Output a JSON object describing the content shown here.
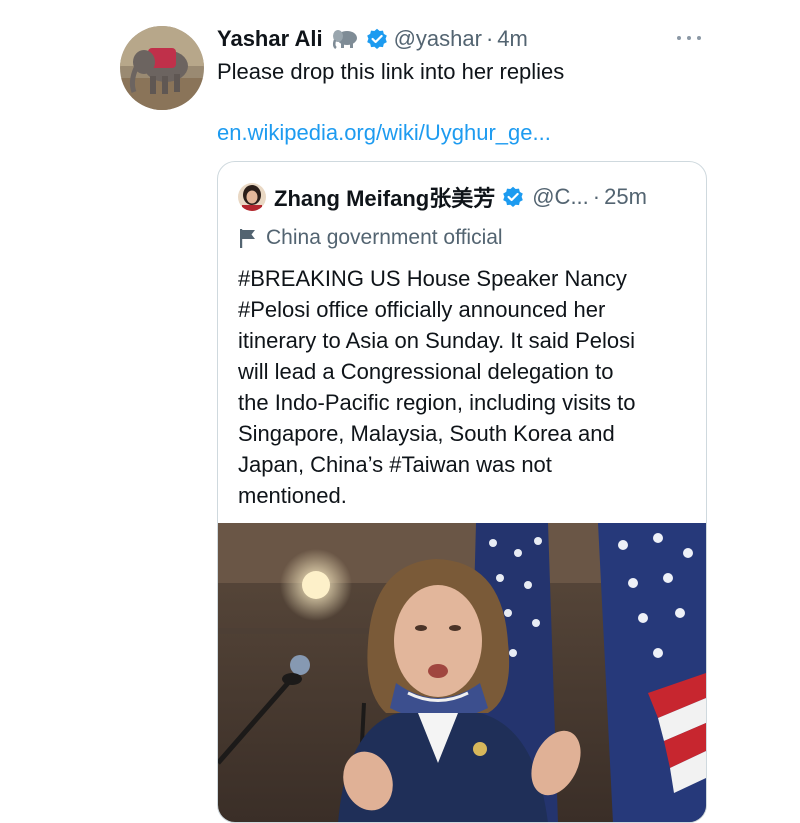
{
  "tweet": {
    "author_name": "Yashar Ali",
    "author_emoji": "elephant-emoji",
    "verified_icon": "verified-badge-icon",
    "handle": "@yashar",
    "separator": "·",
    "time": "4m",
    "more_icon": "more-options-icon",
    "text": "Please drop this link into her replies",
    "link": "en.wikipedia.org/wiki/Uyghur_ge..."
  },
  "quote": {
    "author_name": "Zhang Meifang张美芳",
    "handle": "@C...",
    "separator": "·",
    "time": "25m",
    "label": "China government official",
    "label_icon": "flag-icon",
    "body_lines": [
      "#BREAKING US House Speaker Nancy",
      "#Pelosi office officially announced her",
      "itinerary to Asia on Sunday. It said Pelosi",
      "will lead a Congressional delegation to",
      "the Indo-Pacific region, including visits to",
      "Singapore, Malaysia, South Korea and",
      "Japan, China’s #Taiwan was not",
      "mentioned."
    ]
  },
  "colors": {
    "link": "#1d9bf0",
    "verified": "#1d9bf0",
    "secondary_text": "#536471",
    "card_border": "#cfd9de",
    "primary_text": "#0f1419"
  }
}
